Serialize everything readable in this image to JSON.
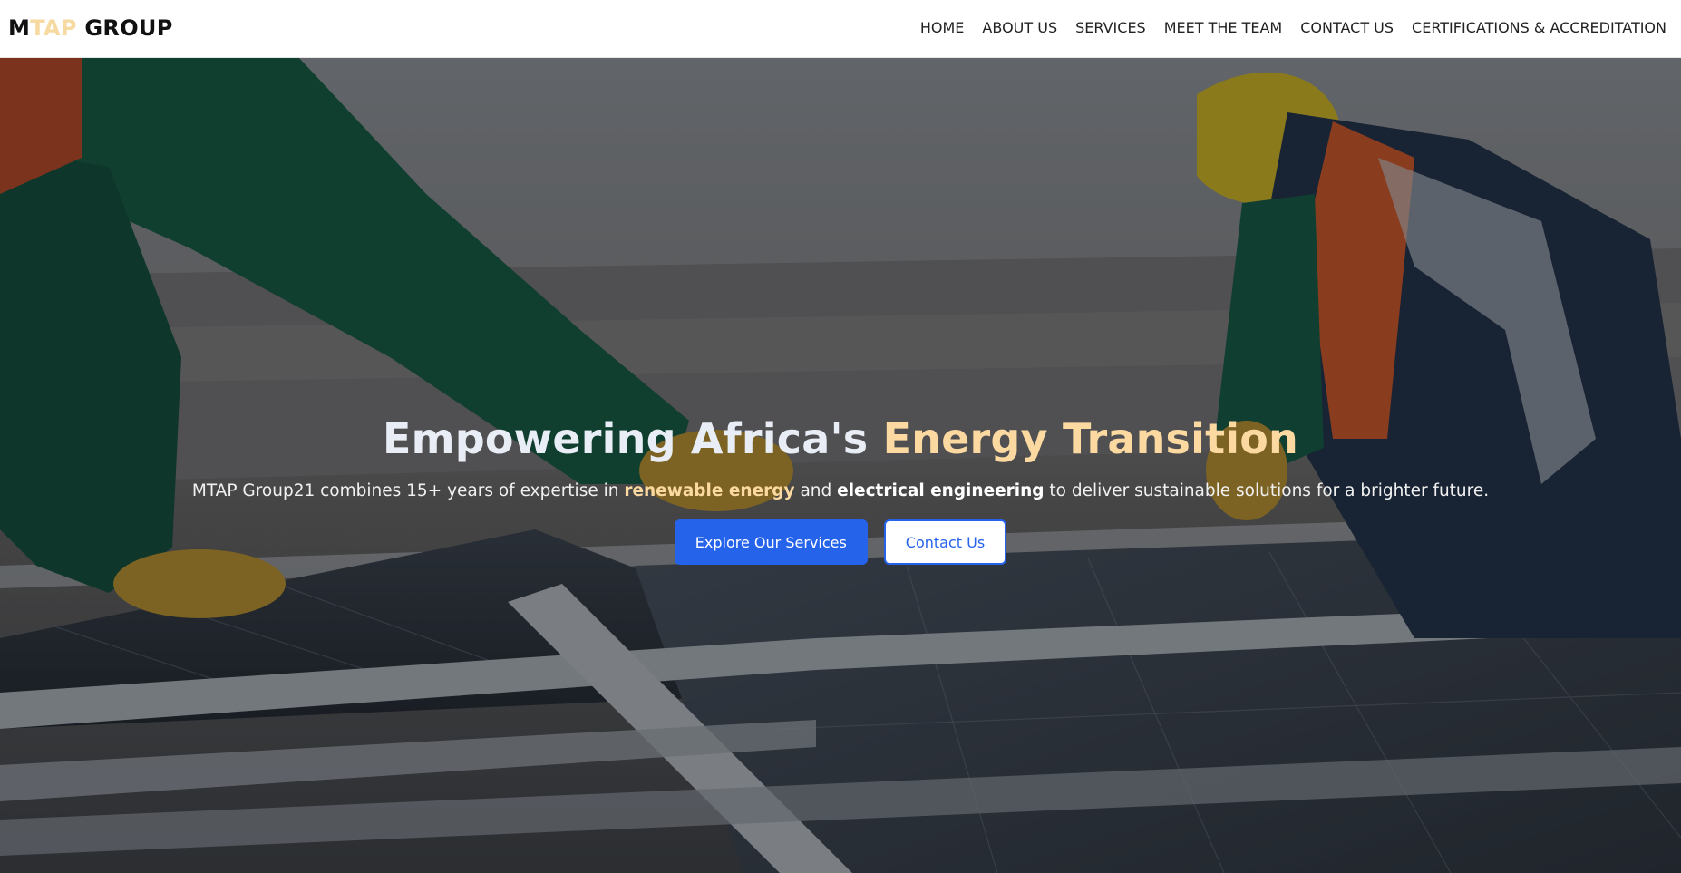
{
  "header": {
    "logo": {
      "part1": "M",
      "part2": "TAP",
      "part3": " GROUP"
    },
    "nav": [
      {
        "label": "HOME"
      },
      {
        "label": "ABOUT US"
      },
      {
        "label": "SERVICES"
      },
      {
        "label": "MEET THE TEAM"
      },
      {
        "label": "CONTACT US"
      },
      {
        "label": "CERTIFICATIONS & ACCREDITATION"
      }
    ]
  },
  "hero": {
    "title_main": "Empowering Africa's ",
    "title_highlight": "Energy Transition",
    "subtitle": {
      "part1": "MTAP Group21 combines 15+ years of expertise in ",
      "highlight1": "renewable energy",
      "part2": " and ",
      "highlight2": "electrical engineering",
      "part3": " to deliver sustainable solutions for a brighter future."
    },
    "primary_cta": "Explore Our Services",
    "secondary_cta": "Contact Us"
  },
  "colors": {
    "accent_gold": "#fbd9a0",
    "button_blue": "#2563eb",
    "logo_accent": "#f7d9a2"
  }
}
